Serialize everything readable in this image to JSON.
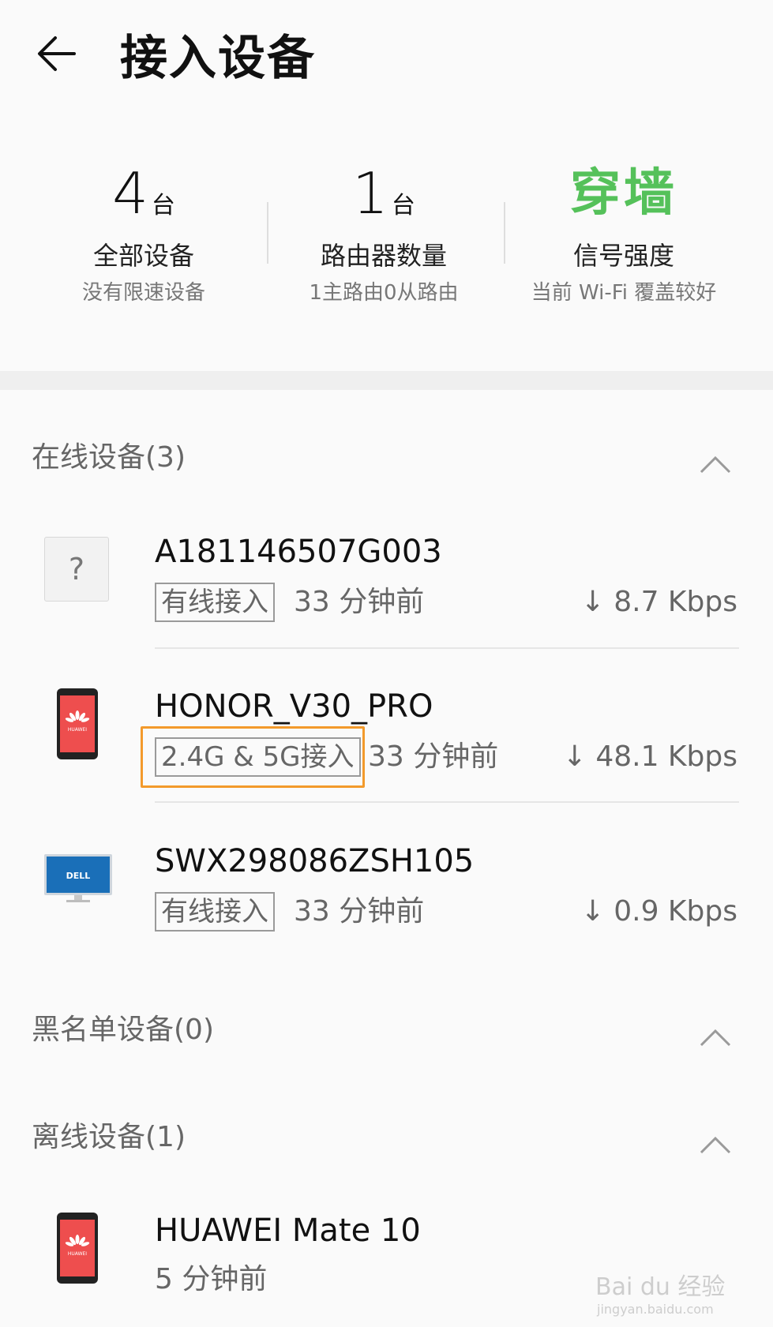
{
  "header": {
    "title": "接入设备"
  },
  "stats": [
    {
      "number": "4",
      "unit": "台",
      "label": "全部设备",
      "sub": "没有限速设备"
    },
    {
      "number": "1",
      "unit": "台",
      "label": "路由器数量",
      "sub": "1主路由0从路由"
    },
    {
      "value": "穿墙",
      "label": "信号强度",
      "sub": "当前 Wi-Fi 覆盖较好",
      "value_color": "#55c15a"
    }
  ],
  "sections": {
    "online": {
      "title": "在线设备(3)"
    },
    "blacklist": {
      "title": "黑名单设备(0)"
    },
    "offline": {
      "title": "离线设备(1)"
    }
  },
  "online_devices": [
    {
      "name": "A181146507G003",
      "tag": "有线接入",
      "time": "33 分钟前",
      "rate": "↓ 8.7 Kbps",
      "icon": "unknown-device-icon"
    },
    {
      "name": "HONOR_V30_PRO",
      "tag": "2.4G & 5G接入",
      "time": "33 分钟前",
      "rate": "↓ 48.1 Kbps",
      "icon": "huawei-phone-icon"
    },
    {
      "name": "SWX298086ZSH105",
      "tag": "有线接入",
      "time": "33 分钟前",
      "rate": "↓ 0.9 Kbps",
      "icon": "dell-monitor-icon"
    }
  ],
  "offline_devices": [
    {
      "name": "HUAWEI Mate 10",
      "time": "5 分钟前",
      "icon": "huawei-phone-icon"
    }
  ],
  "icon_text": {
    "unknown": "?",
    "huawei": "HUAWEI",
    "dell": "DELL"
  },
  "watermark": {
    "brand": "Bai du 经验",
    "url": "jingyan.baidu.com"
  },
  "colors": {
    "highlight": "#f39a2b",
    "accent_green": "#55c15a"
  }
}
